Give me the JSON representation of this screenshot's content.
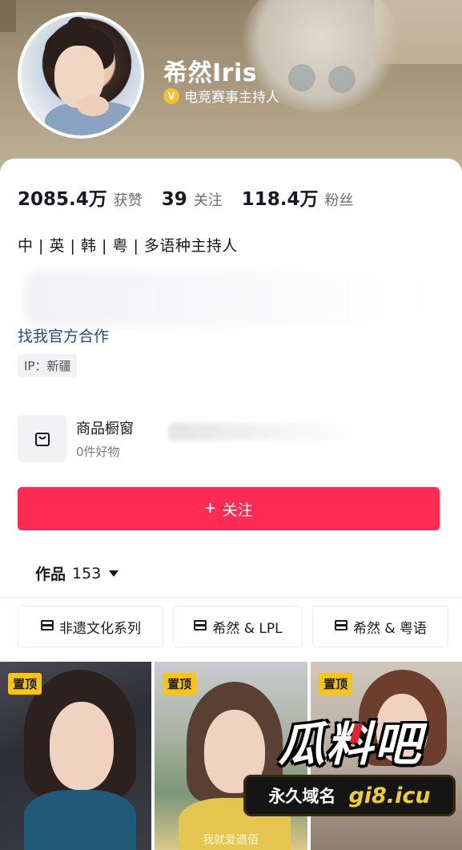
{
  "profile": {
    "nickname": "希然Iris",
    "verify_icon": "V",
    "verify_text": "电竞赛事主持人"
  },
  "stats": [
    {
      "value": "2085.4万",
      "label": "获赞"
    },
    {
      "value": "39",
      "label": "关注"
    },
    {
      "value": "118.4万",
      "label": "粉丝"
    }
  ],
  "bio": "中 | 英 | 韩 | 粤 | 多语种主持人",
  "cooperation_link": "找我官方合作",
  "ip_location": "IP：新疆",
  "shop": {
    "title": "商品橱窗",
    "subtitle": "0件好物",
    "icon": "shopping-bag-icon"
  },
  "follow_button": {
    "plus": "+",
    "label": "关注"
  },
  "works": {
    "label": "作品",
    "count": "153"
  },
  "collections": [
    {
      "label": "非遗文化系列",
      "icon": "collection-stack-icon"
    },
    {
      "label": "希然 & LPL",
      "icon": "collection-stack-icon"
    },
    {
      "label": "希然 & 粤语",
      "icon": "collection-stack-icon"
    }
  ],
  "videos": [
    {
      "pinned_label": "置顶"
    },
    {
      "pinned_label": "置顶",
      "caption": "我就爱遗佰"
    },
    {
      "pinned_label": "置顶"
    }
  ],
  "watermark": {
    "title": "瓜料吧",
    "left": "永久域名",
    "right": "gi8.icu"
  },
  "colors": {
    "accent": "#fe2c55",
    "pin_badge": "#f5c518",
    "link": "#2b4c7e"
  }
}
